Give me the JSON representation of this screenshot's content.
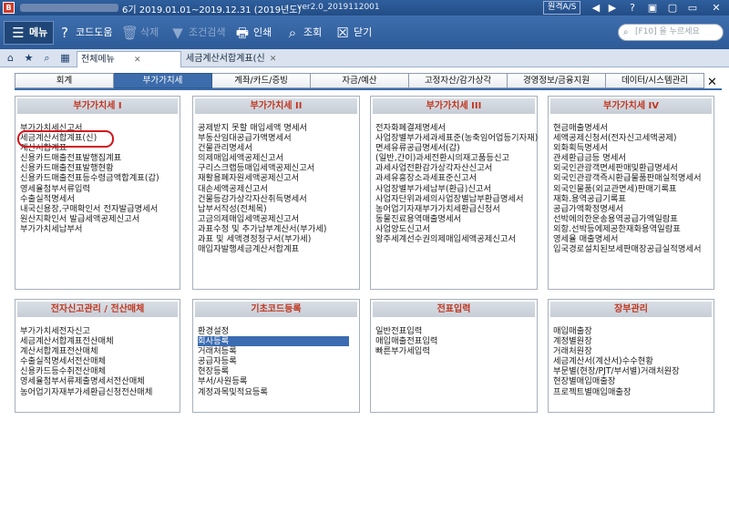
{
  "titlebar": {
    "logo": "B",
    "period": "6기 2019.01.01~2019.12.31 (2019년도)",
    "version": "ver2.0_2019112001",
    "remote_as": "원격A/S",
    "buttons": [
      "◀",
      "▶",
      "?",
      "▣",
      "▢",
      "▭",
      "✕"
    ]
  },
  "toolbar": {
    "menu": "메뉴",
    "code_help": "코드도움",
    "delete": "삭제",
    "filter": "조건검색",
    "print": "인쇄",
    "view": "조회",
    "close": "닫기",
    "search_placeholder": "[F10] 을 누르세요"
  },
  "tabs": {
    "all_menu": "전체메뉴",
    "tax_invoice": "세금계산서합계표(신"
  },
  "categories": [
    "회계",
    "부가가치세",
    "계좌/카드/증빙",
    "자금/예산",
    "고정자산/감가상각",
    "경영정보/금융지원",
    "데이터/시스템관리"
  ],
  "active_category": 1,
  "panels": [
    {
      "title": "부가가치세 I",
      "items": [
        "부가가치세신고서",
        "세금계산서합계표(신)",
        "계산서합계표",
        "신용카드매출전표발행집계표",
        "신용카드매출전표발행현황",
        "신용카드매출전표등수령금액합계표(갑)",
        "영세율첨부서류입력",
        "수출실적명세서",
        "내국신용장,구매확인서 전자발급명세서",
        "원산지확인서 발급세액공제신고서",
        "부가가치세납부서"
      ]
    },
    {
      "title": "부가가치세 II",
      "items": [
        "공제받지 못할 매입세액 명세서",
        "부동산임대공급가액명세서",
        "건물관리명세서",
        "의제매입세액공제신고서",
        "구리스크랩등매입세액공제신고서",
        "재활용폐자원세액공제신고서",
        "대손세액공제신고서",
        "건물등감가상각자산취득명세서",
        "납부서작성(전체목)",
        "고금의제매입세액공제신고서",
        "과표수정 및 추가납부계산서(부가세)",
        "과표 및 세액경정청구서(부가세)",
        "매입자발행세금계산서합계표"
      ]
    },
    {
      "title": "부가가치세 III",
      "items": [
        "전자화폐결제명세서",
        "사업장별부가세과세표준(농축임어업등기자재)",
        "면세유류공급명세서(갑)",
        "(일반,간이)과세전환시의재고품등신고",
        "과세사업전환감가상각자산신고서",
        "과세유흥장소과세표준신고서",
        "사업장별부가세납부(환급)신고서",
        "사업자단위과세의사업장별납부환급명세서",
        "농어업기자재부가가치세환급신청서",
        "동물진료용역매출명세서",
        "사업양도신고서",
        "왕주세계선수권의제매입세액공제신고서"
      ]
    },
    {
      "title": "부가가치세 IV",
      "items": [
        "현금매출명세서",
        "세액공제신청서(전자신고세액공제)",
        "외화획득명세서",
        "관세환급금등 명세서",
        "외국인관광객면세판매및환급명세서",
        "외국인관광객즉시환급물품판매실적명세서",
        "외국인물품(외교관면세)판매기록표",
        "재화.용역공급기록표",
        "공급가액확정명세서",
        "선박에의한운송용역공급가액일람표",
        "외항.선박등에제공한재화용역일람표",
        "영세율 매출명세서",
        "입국경로설치된보세판매장공급실적명세서"
      ]
    },
    {
      "title": "전자신고관리 / 전산매체",
      "items": [
        "부가가치세전자신고",
        "세금계산서합계표전산매체",
        "계산서합계표전산매체",
        "수출실적명세서전산매체",
        "신용카드등수취전산매체",
        "영세율첨부서류제출명세서전산매체",
        "농어업기자재부가세환급신청전산매체"
      ]
    },
    {
      "title": "기초코드등록",
      "items": [
        "환경설정",
        "회사등록",
        "거래처등록",
        "공급자등록",
        "현장등록",
        "부서/사원등록",
        "계정과목및적요등록"
      ]
    },
    {
      "title": "전표입력",
      "items": [
        "일반전표입력",
        "매입매출전표입력",
        "빠른부가세입력"
      ]
    },
    {
      "title": "장부관리",
      "items": [
        "매입매출장",
        "계정별원장",
        "거래처원장",
        "세금계산서(계산서)수수현황",
        "부문별(현장/PJT/부서별)거래처원장",
        "현장별매입매출장",
        "프로젝트별매입매출장"
      ]
    }
  ],
  "highlight": {
    "circled_item": "세금계산서합계표(신)",
    "selected_item": "회사등록"
  },
  "colors": {
    "accent": "#3c6cab",
    "panel_title": "#c0361f",
    "annotation": "#d4141c"
  }
}
